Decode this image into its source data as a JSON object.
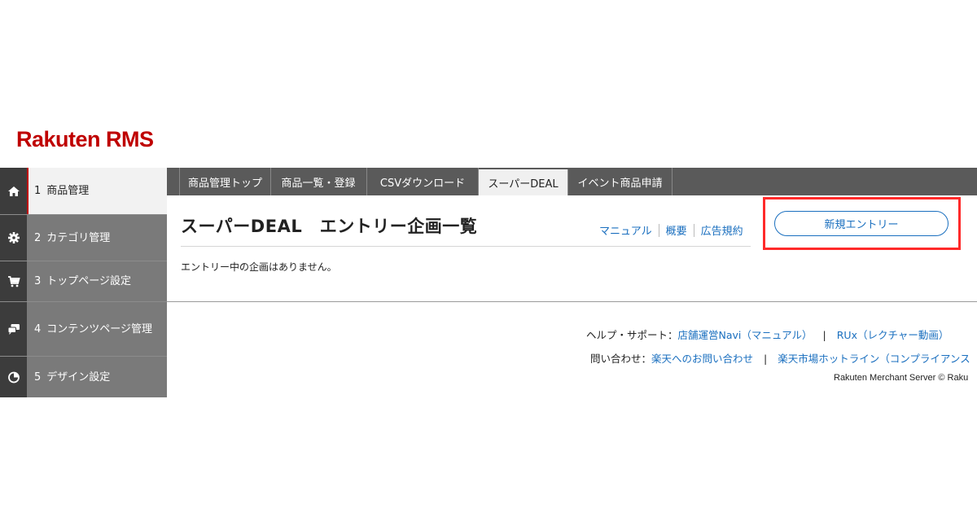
{
  "brand": {
    "logo_text": "Rakuten RMS",
    "accent_color": "#bf0000"
  },
  "sidebar": {
    "items": [
      {
        "num": "1",
        "label": "商品管理",
        "icon": "home-icon",
        "active": true
      },
      {
        "num": "2",
        "label": "カテゴリ管理",
        "icon": "gear-icon",
        "active": false
      },
      {
        "num": "3",
        "label": "トップページ設定",
        "icon": "cart-icon",
        "active": false
      },
      {
        "num": "4",
        "label": "コンテンツページ管理",
        "icon": "chat-icon",
        "active": false
      },
      {
        "num": "5",
        "label": "デザイン設定",
        "icon": "pie-chart-icon",
        "active": false
      }
    ]
  },
  "tabs": [
    {
      "label": "商品管理トップ",
      "active": false
    },
    {
      "label": "商品一覧・登録",
      "active": false
    },
    {
      "label": "CSVダウンロード",
      "active": false
    },
    {
      "label": "スーパーDEAL",
      "active": true
    },
    {
      "label": "イベント商品申請",
      "active": false
    }
  ],
  "main": {
    "title": "スーパーDEAL　エントリー企画一覧",
    "links": [
      "マニュアル",
      "概要",
      "広告規約"
    ],
    "new_entry_label": "新規エントリー",
    "empty_message": "エントリー中の企画はありません。",
    "highlight_color": "#ff2a2a",
    "link_color": "#1a6fbf"
  },
  "footer": {
    "help_prefix": "ヘルプ・サポート：",
    "help_link_1": "店舗運営Navi（マニュアル）",
    "help_sep": "|",
    "help_link_2": "RUx（レクチャー動画）",
    "contact_prefix": "問い合わせ：",
    "contact_link_1": "楽天へのお問い合わせ",
    "contact_sep": "|",
    "contact_link_2": "楽天市場ホットライン（コンプライアンス",
    "copyright": "Rakuten Merchant Server © Raku"
  }
}
